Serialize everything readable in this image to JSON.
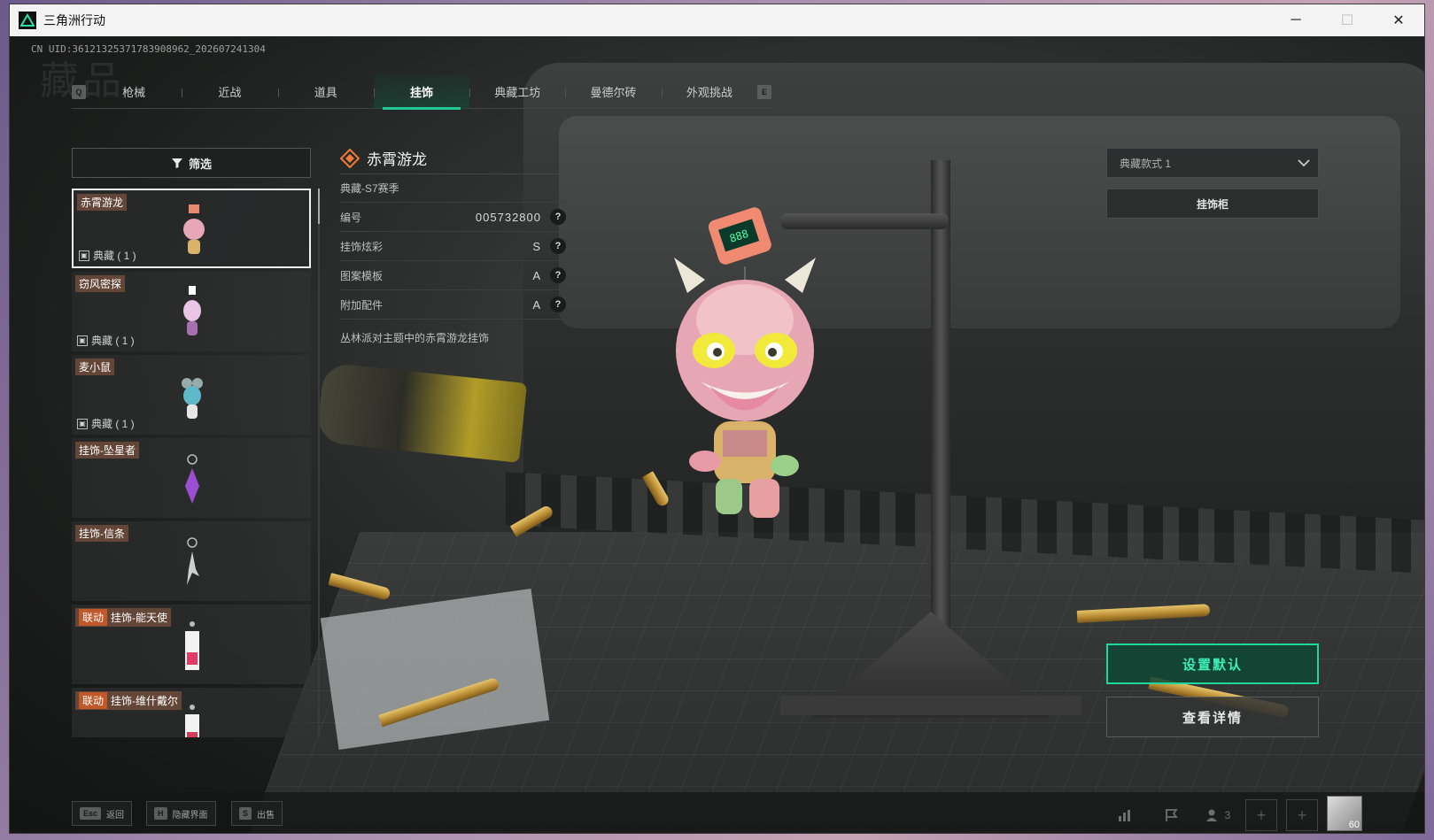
{
  "window": {
    "title": "三角洲行动",
    "controls": {
      "minimize": "─",
      "maximize": "☐",
      "close": "✕"
    }
  },
  "header": {
    "uid": "CN UID:361213253717839089​62_202607241304",
    "watermark": "藏品"
  },
  "tabs": {
    "left_key": "Q",
    "right_key": "E",
    "items": [
      {
        "label": "枪械",
        "active": false
      },
      {
        "label": "近战",
        "active": false
      },
      {
        "label": "道具",
        "active": false
      },
      {
        "label": "挂饰",
        "active": true
      },
      {
        "label": "典藏工坊",
        "active": false
      },
      {
        "label": "曼德尔砖",
        "active": false
      },
      {
        "label": "外观挑战",
        "active": false
      }
    ]
  },
  "filter": {
    "label": "筛选"
  },
  "items": [
    {
      "name": "赤霄游龙",
      "tag": "",
      "meta": "典藏 ( 1 )",
      "selected": true
    },
    {
      "name": "窃风密探",
      "tag": "",
      "meta": "典藏 ( 1 )",
      "selected": false
    },
    {
      "name": "麦小鼠",
      "tag": "",
      "meta": "典藏 ( 1 )",
      "selected": false
    },
    {
      "name": "挂饰-坠星者",
      "tag": "",
      "meta": "",
      "selected": false
    },
    {
      "name": "挂饰-信条",
      "tag": "",
      "meta": "",
      "selected": false
    },
    {
      "name": "挂饰-能天使",
      "tag": "联动",
      "meta": "",
      "selected": false
    },
    {
      "name": "挂饰-维什戴尔",
      "tag": "联动",
      "meta": "",
      "selected": false
    }
  ],
  "detail": {
    "title": "赤霄游龙",
    "season": "典藏-S7赛季",
    "rows": [
      {
        "label": "编号",
        "value": "005732800"
      },
      {
        "label": "挂饰炫彩",
        "value": "S"
      },
      {
        "label": "图案模板",
        "value": "A"
      },
      {
        "label": "附加配件",
        "value": "A"
      }
    ],
    "description": "丛林派对主题中的赤霄游龙挂饰"
  },
  "right_panel": {
    "style_select": "典藏款式 1",
    "cabinet_label": "挂饰柜",
    "set_default_label": "设置默认",
    "view_details_label": "查看详情"
  },
  "bottom_bar": {
    "hints": [
      {
        "key": "Esc",
        "label": "返回"
      },
      {
        "key": "H",
        "label": "隐藏界面"
      },
      {
        "key": "S",
        "label": "出售"
      }
    ],
    "party_count": "3",
    "avatar_level": "60"
  },
  "colors": {
    "accent": "#1fd69c",
    "tag_collab": "#c0582a",
    "tab_active_underline": "#22c997"
  }
}
